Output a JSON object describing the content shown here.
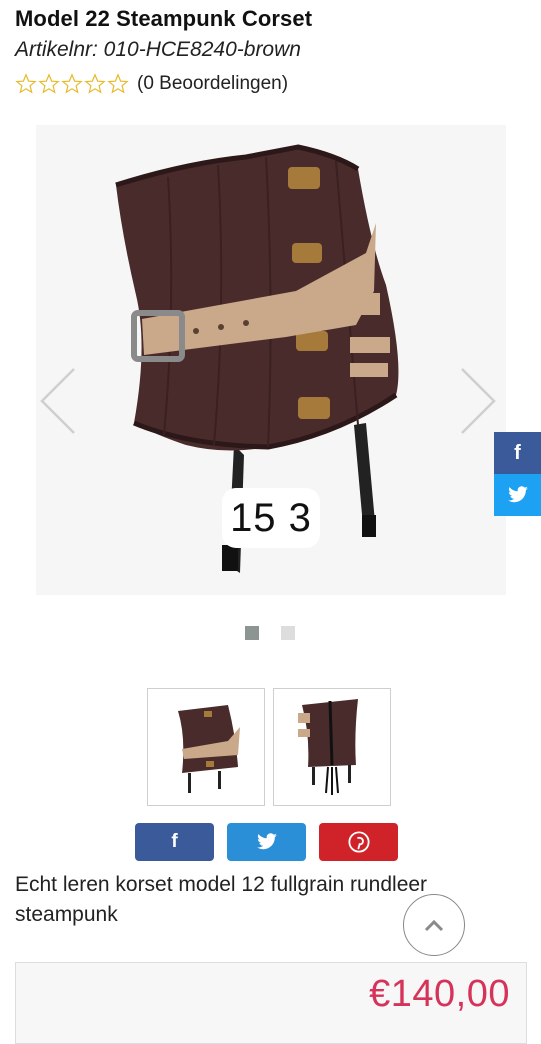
{
  "product": {
    "title": "Model 22 Steampunk Corset",
    "sku": "Artikelnr: 010-HCE8240-brown",
    "rating_stars": 0,
    "rating_max": 5,
    "reviews_label": "(0 Beoordelingen)",
    "description": "Echt leren korset model 12 fullgrain rundleer steampunk",
    "price": "€140,00"
  },
  "gallery": {
    "caption": "15 3",
    "slide_count": 2,
    "active_slide": 1,
    "thumbnail_count": 2
  },
  "colors": {
    "star_outline": "#e8b927",
    "facebook": "#3b5a9a",
    "twitter": "#2b8fd8",
    "pinterest": "#cf2229",
    "price": "#d6335a"
  },
  "icons": {
    "prev": "chevron-left-icon",
    "next": "chevron-right-icon",
    "facebook": "facebook-icon",
    "twitter": "twitter-icon",
    "pinterest": "pinterest-icon",
    "scroll_top": "chevron-up-icon"
  }
}
